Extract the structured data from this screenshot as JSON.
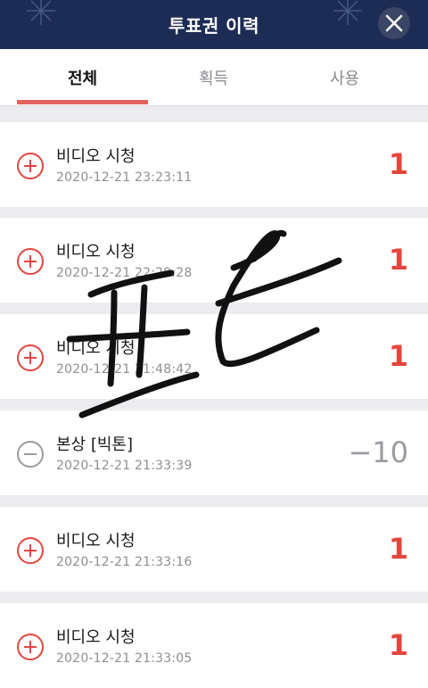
{
  "header": {
    "title": "투표권 이력",
    "close_icon": "close-icon"
  },
  "tabs": [
    {
      "label": "전체",
      "active": true
    },
    {
      "label": "획득",
      "active": false
    },
    {
      "label": "사용",
      "active": false
    }
  ],
  "colors": {
    "accent": "#e3463f",
    "header_bg": "#1d2c55",
    "muted": "#9a9aa0"
  },
  "history": [
    {
      "label": "비디오 시청",
      "time": "2020-12-21 23:23:11",
      "amount": "1",
      "type": "plus"
    },
    {
      "label": "비디오 시청",
      "time": "2020-12-21 22:29:28",
      "amount": "1",
      "type": "plus"
    },
    {
      "label": "비디오 시청",
      "time": "2020-12-21 21:48:42",
      "amount": "1",
      "type": "plus"
    },
    {
      "label": "본상 [빅톤]",
      "time": "2020-12-21 21:33:39",
      "amount": "−10",
      "type": "minus"
    },
    {
      "label": "비디오 시청",
      "time": "2020-12-21 21:33:16",
      "amount": "1",
      "type": "plus"
    },
    {
      "label": "비디오 시청",
      "time": "2020-12-21 21:33:05",
      "amount": "1",
      "type": "plus"
    }
  ]
}
